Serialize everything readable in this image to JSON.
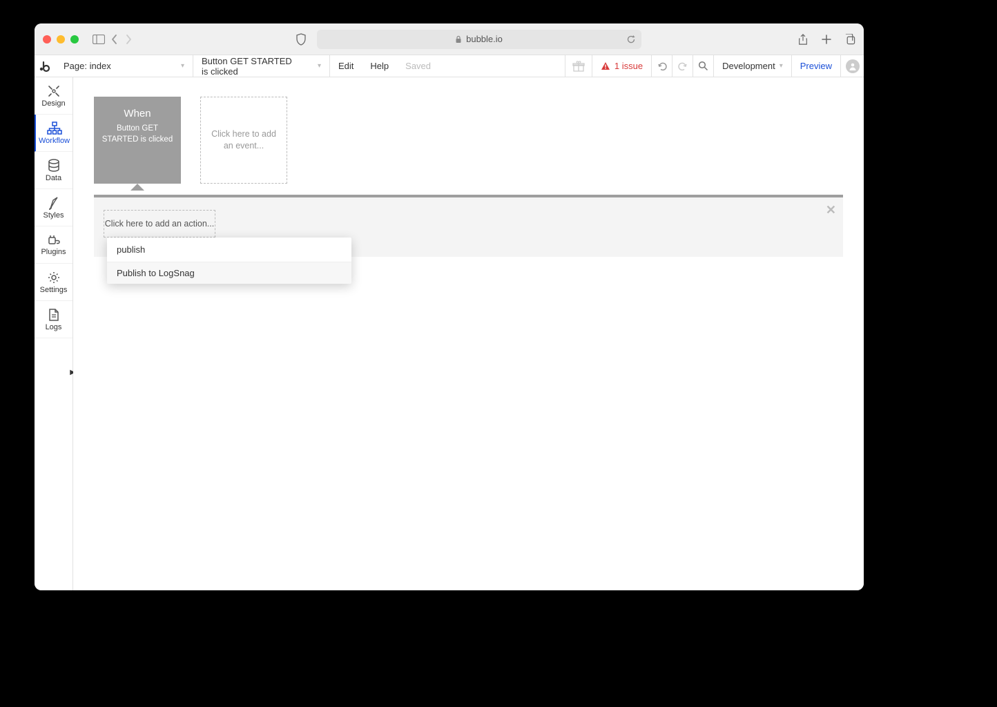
{
  "browser": {
    "url": "bubble.io"
  },
  "appbar": {
    "page_label_prefix": "Page:",
    "page_name": "index",
    "event_name": "Button GET STARTED is clicked",
    "edit": "Edit",
    "help": "Help",
    "saved": "Saved",
    "issues_count": "1 issue",
    "environment": "Development",
    "preview": "Preview"
  },
  "sidebar": {
    "items": [
      {
        "label": "Design"
      },
      {
        "label": "Workflow"
      },
      {
        "label": "Data"
      },
      {
        "label": "Styles"
      },
      {
        "label": "Plugins"
      },
      {
        "label": "Settings"
      },
      {
        "label": "Logs"
      }
    ]
  },
  "events": {
    "selected": {
      "when": "When",
      "desc": "Button GET STARTED is clicked"
    },
    "add_placeholder": "Click here to add an event..."
  },
  "actions": {
    "add_placeholder": "Click here to add an action..."
  },
  "dropdown": {
    "search_value": "publish",
    "option_0": "Publish to LogSnag"
  }
}
